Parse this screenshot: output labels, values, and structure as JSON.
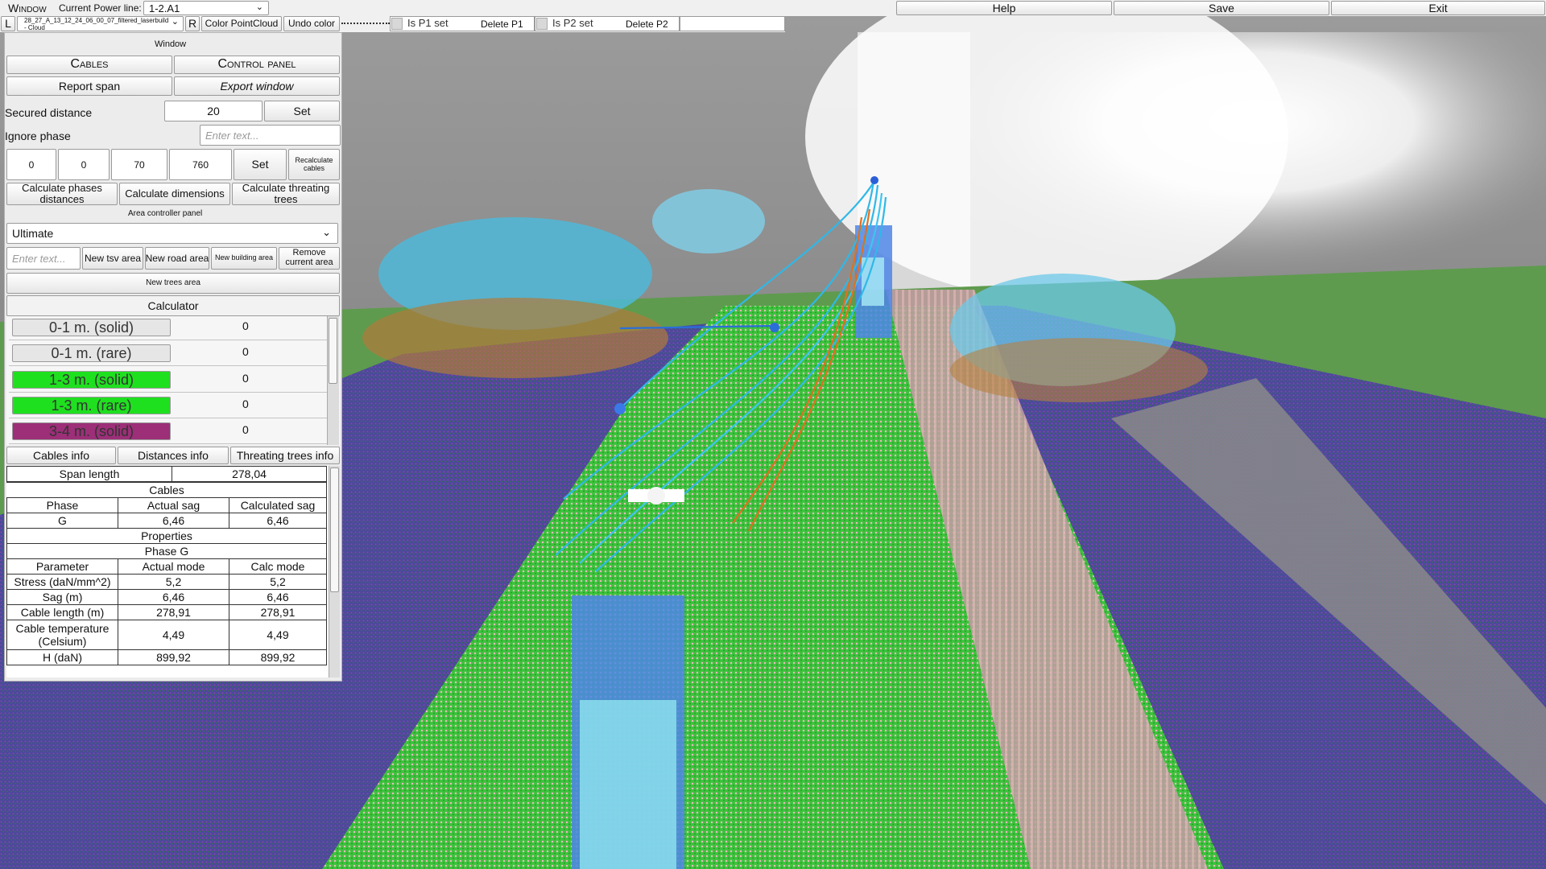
{
  "menu": {
    "window_label": "Window",
    "power_line_label": "Current Power line:",
    "power_line_value": "1-2.A1",
    "help": "Help",
    "save": "Save",
    "exit": "Exit"
  },
  "toolbar": {
    "left_btn": "L",
    "cloud_name": "28_27_A_13_12_24_06_00_07_filtered_laserbuild - Cloud",
    "right_btn": "R",
    "color_pointcloud": "Color PointCloud",
    "undo_color": "Undo color",
    "p1_toggle": "Is P1 set",
    "delete_p1": "Delete P1",
    "p2_toggle": "Is P2 set",
    "delete_p2": "Delete P2"
  },
  "panel": {
    "title": "Window",
    "tab_cables": "Cables",
    "tab_control": "Control panel",
    "report_span": "Report span",
    "export_window": "Export window",
    "secured_distance_label": "Secured distance",
    "secured_distance_value": "20",
    "set": "Set",
    "ignore_phase_label": "Ignore phase",
    "ignore_phase_placeholder": "Enter text...",
    "coord_values": [
      "0",
      "0",
      "70",
      "760"
    ],
    "recalculate": "Recalculate cables",
    "calc_phases": "Calculate phases distances",
    "calc_dimensions": "Calculate dimensions",
    "calc_threating": "Calculate threating trees",
    "area_panel_label": "Area controller panel",
    "area_select_value": "Ultimate",
    "area_name_placeholder": "Enter text...",
    "new_tsv": "New tsv area",
    "new_road": "New road area",
    "new_building": "New building area",
    "remove_area": "Remove current area",
    "new_trees": "New trees area",
    "calculator_label": "Calculator"
  },
  "calculator_rows": [
    {
      "label": "0-1 m. (solid)",
      "value": "0",
      "color": "#e6e6e6"
    },
    {
      "label": "0-1 m. (rare)",
      "value": "0",
      "color": "#e6e6e6"
    },
    {
      "label": "1-3 m. (solid)",
      "value": "0",
      "color": "#1fe01f"
    },
    {
      "label": "1-3 m. (rare)",
      "value": "0",
      "color": "#1fe01f"
    },
    {
      "label": "3-4 m. (solid)",
      "value": "0",
      "color": "#9c2f78"
    }
  ],
  "info_tabs": {
    "cables_info": "Cables info",
    "distances_info": "Distances info",
    "threating_info": "Threating trees info"
  },
  "info": {
    "span_length_label": "Span length",
    "span_length_value": "278,04",
    "cables_header": "Cables",
    "phase_col": "Phase",
    "actual_sag_col": "Actual sag",
    "calc_sag_col": "Calculated sag",
    "phase_row": {
      "phase": "G",
      "actual": "6,46",
      "calc": "6,46"
    },
    "properties_header": "Properties",
    "phase_header": "Phase G",
    "param_col": "Parameter",
    "actual_mode_col": "Actual mode",
    "calc_mode_col": "Calc mode",
    "params": [
      {
        "name": "Stress (daN/mm^2)",
        "actual": "5,2",
        "calc": "5,2"
      },
      {
        "name": "Sag (m)",
        "actual": "6,46",
        "calc": "6,46"
      },
      {
        "name": "Cable length (m)",
        "actual": "278,91",
        "calc": "278,91"
      },
      {
        "name": "Cable temperature (Celsium)",
        "actual": "4,49",
        "calc": "4,49"
      },
      {
        "name": "H (daN)",
        "actual": "899,92",
        "calc": "899,92"
      }
    ]
  }
}
